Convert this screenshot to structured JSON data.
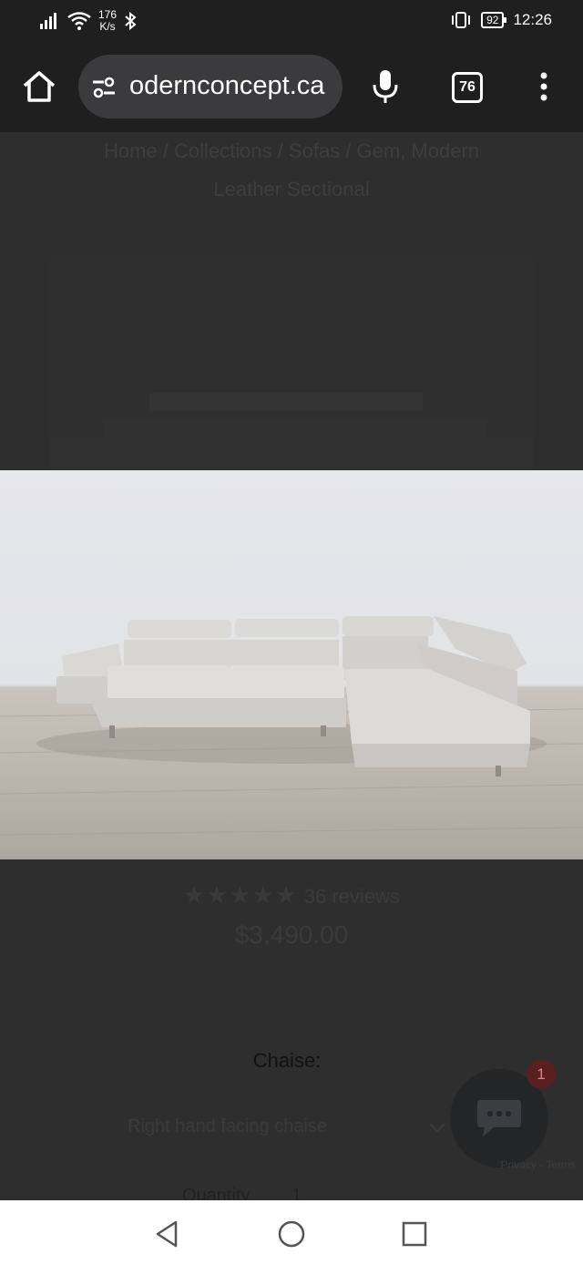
{
  "status_bar": {
    "net_speed_value": "176",
    "net_speed_unit": "K/s",
    "battery": "92",
    "time": "12:26"
  },
  "browser": {
    "url": "odernconcept.ca",
    "tab_count": "76"
  },
  "page": {
    "breadcrumb_line1": "Home / Collections / Sofas / Gem, Modern",
    "breadcrumb_line2": "Leather Sectional",
    "rating": {
      "stars": 5,
      "reviews": "36 reviews"
    },
    "price": "$3,490.00",
    "option_label": "Chaise:",
    "select_value": "Right hand facing chaise",
    "quantity_label": "Quantity",
    "quantity_value": "1"
  },
  "chat": {
    "badge": "1",
    "recaptcha_text": "Privacy - Terms"
  },
  "colors": {
    "chrome": "#1f1f1f",
    "page_overlay": "#2e2e2f",
    "pill": "#3b3b3d"
  }
}
